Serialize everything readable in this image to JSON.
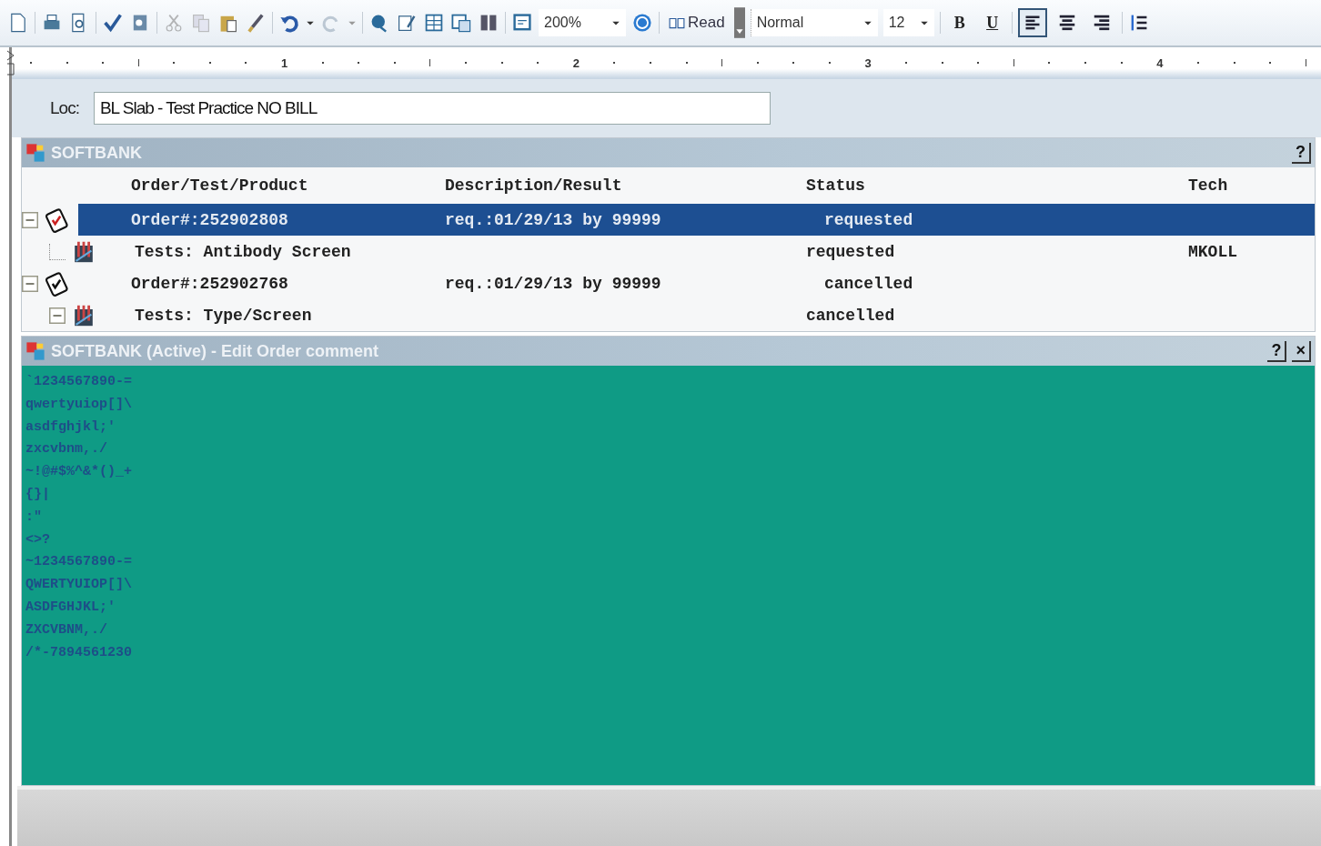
{
  "toolbar": {
    "zoom": "200%",
    "read_label": "Read",
    "style": "Normal",
    "font_size": "12",
    "bold_label": "B",
    "underline_label": "U",
    "alignments": [
      {
        "kind": "left",
        "selected": true
      },
      {
        "kind": "center",
        "selected": false
      },
      {
        "kind": "right",
        "selected": false
      }
    ]
  },
  "ruler": {
    "marks": [
      "1",
      "2",
      "3",
      "4"
    ]
  },
  "location": {
    "label": "Loc:",
    "value": "BL Slab - Test Practice NO BILL"
  },
  "orders_panel": {
    "title": "SOFTBANK",
    "help": "?",
    "columns": [
      "Order/Test/Product",
      "Description/Result",
      "Status",
      "Tech"
    ],
    "rows": [
      {
        "kind": "order",
        "selected": true,
        "expanded": true,
        "order": "Order#:252902808",
        "description": "req.:01/29/13 by 99999",
        "status": "requested",
        "children": [
          {
            "kind": "test",
            "selected": false,
            "order": "Tests: Antibody Screen",
            "status": "requested",
            "tech": "MKOLL"
          }
        ]
      },
      {
        "kind": "order",
        "selected": false,
        "expanded": true,
        "order": "Order#:252902768",
        "description": "req.:01/29/13 by 99999",
        "status": "cancelled",
        "children": [
          {
            "kind": "test",
            "selected": false,
            "expanded": true,
            "order": "Tests: Type/Screen",
            "status": "cancelled"
          }
        ]
      }
    ]
  },
  "comment_panel": {
    "title": "SOFTBANK (Active) - Edit Order comment",
    "help": "?",
    "close": "×",
    "lines": [
      "`1234567890-=",
      "qwertyuiop[]\\",
      "asdfghjkl;'",
      "zxcvbnm,./",
      "~!@#$%^&*()_+",
      "{}|",
      ":\"",
      "<>?",
      "~1234567890-=",
      "QWERTYUIOP[]\\",
      "ASDFGHJKL;'",
      "ZXCVBNM,./",
      "/*-7894561230"
    ]
  }
}
